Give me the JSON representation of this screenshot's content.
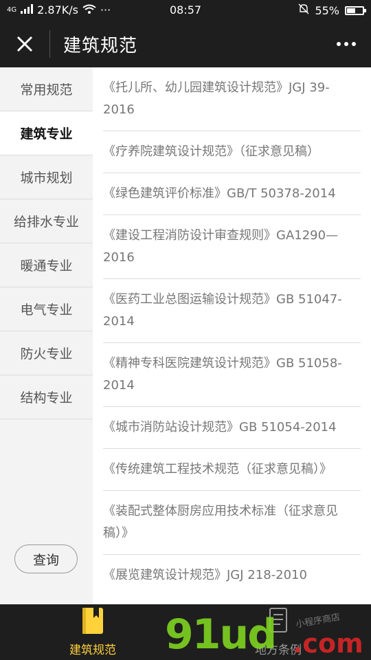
{
  "status_bar": {
    "network": "4G",
    "speed": "2.87K/s",
    "more": "···",
    "time": "08:57",
    "battery_percent": "55%",
    "battery_level": 0.55
  },
  "header": {
    "title": "建筑规范",
    "close_icon": "close-icon",
    "more_icon": "more-dots-icon"
  },
  "sidebar": {
    "items": [
      {
        "label": "常用规范",
        "active": false
      },
      {
        "label": "建筑专业",
        "active": true
      },
      {
        "label": "城市规划",
        "active": false
      },
      {
        "label": "给排水专业",
        "active": false
      },
      {
        "label": "暖通专业",
        "active": false
      },
      {
        "label": "电气专业",
        "active": false
      },
      {
        "label": "防火专业",
        "active": false
      },
      {
        "label": "结构专业",
        "active": false
      }
    ],
    "query_label": "查询"
  },
  "list": {
    "items": [
      "《托儿所、幼儿园建筑设计规范》JGJ 39-2016",
      "《疗养院建筑设计规范》（征求意见稿）",
      "《绿色建筑评价标准》GB/T 50378-2014",
      "《建设工程消防设计审查规则》GA1290—2016",
      "《医药工业总图运输设计规范》GB 51047-2014",
      "《精神专科医院建筑设计规范》GB 51058-2014",
      "《城市消防站设计规范》GB 51054-2014",
      "《传统建筑工程技术规范（征求意见稿）》",
      "《装配式整体厨房应用技术标准（征求意见稿）》",
      "《展览建筑设计规范》JGJ 218-2010"
    ]
  },
  "tabbar": {
    "tab1": {
      "label": "建筑规范",
      "icon": "book-icon",
      "color": "#ffd23c"
    },
    "tab2": {
      "label": "地方条例",
      "icon": "document-icon"
    }
  },
  "watermark": {
    "logo": "91ud",
    "domain": ".com",
    "tagline": "小程序商店"
  }
}
